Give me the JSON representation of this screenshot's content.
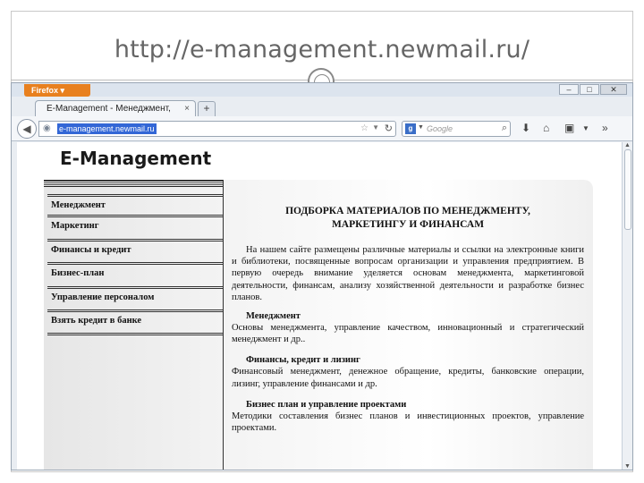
{
  "slide": {
    "title": "http://e-management.newmail.ru/"
  },
  "browser": {
    "menu_label": "Firefox ▾",
    "window_controls": [
      "–",
      "□",
      "✕"
    ],
    "tab": {
      "title": "E-Management - Менеджмент, маркет...",
      "close": "×"
    },
    "new_tab": "+",
    "url": "e-management.newmail.ru",
    "search_placeholder": "Google",
    "search_engine_glyph": "g",
    "icons": [
      "globe-icon",
      "star-icon",
      "reload-icon",
      "search-icon",
      "download-icon",
      "home-icon",
      "bookmarks-icon",
      "overflow-icon"
    ]
  },
  "site": {
    "logo": "E-Management",
    "menu": [
      "Менеджмент",
      "Маркетинг",
      "Финансы и кредит",
      "Бизнес-план",
      "Управление персоналом",
      "Взять кредит в банке"
    ],
    "content": {
      "heading_line1": "ПОДБОРКА МАТЕРИАЛОВ ПО МЕНЕДЖМЕНТУ,",
      "heading_line2": "МАРКЕТИНГУ И ФИНАНСАМ",
      "intro": "На нашем сайте размещены различные материалы и ссылки на электронные книги и библиотеки, посвященные вопросам организации и управления предприятием. В первую очередь внимание уделяется основам менеджмента, маркетинговой деятельности, финансам, анализу хозяйственной деятельности и разработке бизнес планов.",
      "sections": [
        {
          "title": "Менеджмент",
          "text": "Основы менеджмента, управление качеством, инновационный и стратегический менеджмент и др.."
        },
        {
          "title": "Финансы, кредит и лизинг",
          "text": "Финансовый менеджмент, денежное обращение, кредиты, банковские операции, лизинг, управление финансами и др."
        },
        {
          "title": "Бизнес план и управление проектами",
          "text": "Методики составления бизнес планов и инвестиционных проектов, управление проектами."
        }
      ]
    }
  },
  "colors": {
    "firefox_orange": "#e8801f",
    "url_selection": "#3367d6",
    "slide_title": "#666666"
  }
}
